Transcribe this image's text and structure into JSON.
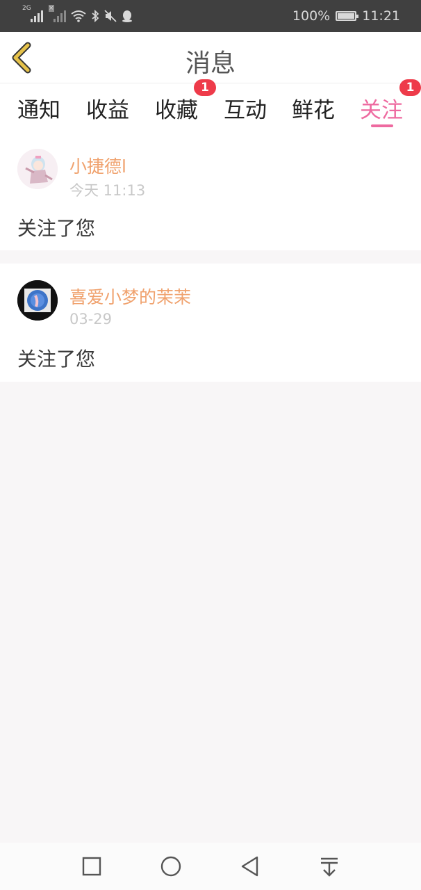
{
  "status_bar": {
    "net1": "2G",
    "battery": "100%",
    "time": "11:21"
  },
  "header": {
    "title": "消息"
  },
  "tabs": [
    {
      "label": "通知",
      "badge": ""
    },
    {
      "label": "收益",
      "badge": ""
    },
    {
      "label": "收藏",
      "badge": "1"
    },
    {
      "label": "互动",
      "badge": ""
    },
    {
      "label": "鲜花",
      "badge": ""
    },
    {
      "label": "关注",
      "badge": "1",
      "active": true
    }
  ],
  "messages": [
    {
      "user": "小捷德l",
      "time": "今天 11:13",
      "text": "关注了您"
    },
    {
      "user": "喜爱小梦的茉茉",
      "time": "03-29",
      "text": "关注了您"
    }
  ],
  "icons": {
    "back": "chevron-left-icon",
    "nav": [
      "square-icon",
      "circle-icon",
      "triangle-back-icon",
      "notification-pull-icon"
    ]
  },
  "colors": {
    "accent": "#ee6aa0",
    "username": "#f0a26e",
    "badge": "#ee3b4a",
    "back_icon": "#e6c24a"
  }
}
